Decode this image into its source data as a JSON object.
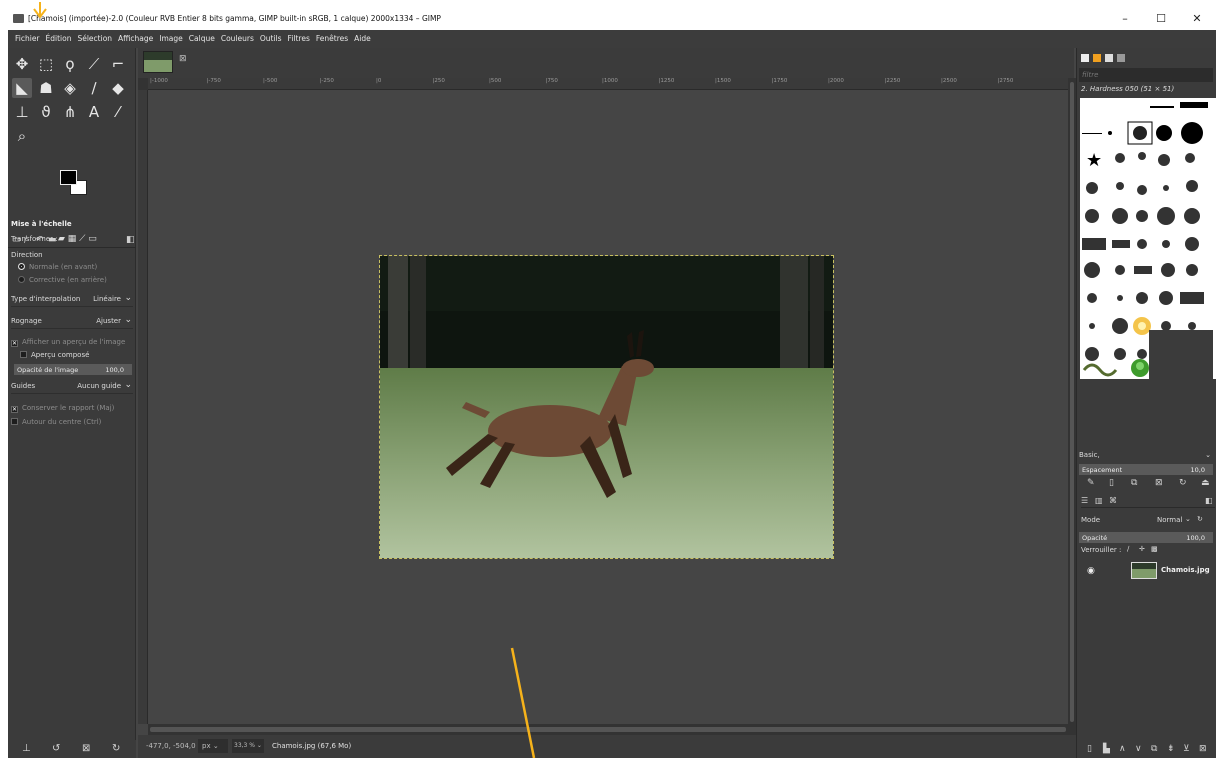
{
  "window": {
    "title": "[Chamois] (importée)-2.0 (Couleur RVB Entier 8 bits gamma, GIMP built-in sRGB, 1 calque) 2000x1334 – GIMP",
    "minimize": "–",
    "maximize": "☐",
    "close": "✕"
  },
  "menu": [
    "Fichier",
    "Édition",
    "Sélection",
    "Affichage",
    "Image",
    "Calque",
    "Couleurs",
    "Outils",
    "Filtres",
    "Fenêtres",
    "Aide"
  ],
  "tool_options": {
    "title": "Mise à l'échelle",
    "transform_label": "Transformer :",
    "direction_label": "Direction",
    "direction_normal": "Normale (en avant)",
    "direction_corrective": "Corrective (en arrière)",
    "interpolation_label": "Type d'interpolation",
    "interpolation_value": "Linéaire",
    "clipping_label": "Rognage",
    "clipping_value": "Ajuster",
    "show_preview": "Afficher un aperçu de l'image",
    "composite_preview": "Aperçu composé",
    "image_opacity_label": "Opacité de l'image",
    "image_opacity_value": "100,0",
    "guides_label": "Guides",
    "guides_value": "Aucun guide",
    "keep_ratio": "Conserver le rapport (Maj)",
    "around_center": "Autour du centre (Ctrl)"
  },
  "ruler": {
    "ticks": [
      "-1000",
      "-750",
      "-500",
      "-250",
      "0",
      "250",
      "500",
      "750",
      "1000",
      "1250",
      "1500",
      "1750",
      "2000",
      "2250",
      "2500",
      "2750"
    ]
  },
  "status": {
    "coords": "-477,0, -504,0",
    "unit": "px",
    "zoom": "33,3 %",
    "file": "Chamois.jpg (67,6 Mo)"
  },
  "brushes": {
    "filter_placeholder": "filtre",
    "current": "2. Hardness 050 (51 × 51)",
    "preset": "Basic,",
    "spacing_label": "Espacement",
    "spacing_value": "10,0"
  },
  "layers": {
    "mode_label": "Mode",
    "mode_value": "Normal",
    "opacity_label": "Opacité",
    "opacity_value": "100,0",
    "lock_label": "Verrouiller :",
    "items": [
      {
        "name": "Chamois.jpg"
      }
    ]
  },
  "colors": {
    "annotation_accent": "#f5b21b",
    "selection_marquee": "#c8c060",
    "foreground": "#000000",
    "background": "#ffffff"
  }
}
